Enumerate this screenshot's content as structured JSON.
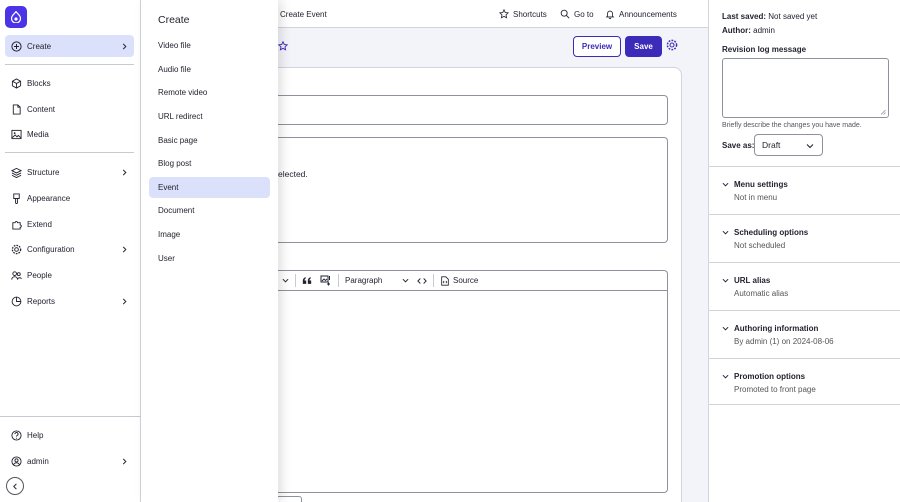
{
  "colors": {
    "accent": "#3c2bb9",
    "active_bg": "#dbe1fb",
    "logo_bg": "#4b33e6"
  },
  "sidebar": {
    "items": [
      {
        "label": "Create",
        "icon": "plus-circle-icon",
        "has_children": true,
        "active": true
      },
      {
        "label": "Blocks",
        "icon": "blocks-icon",
        "has_children": false
      },
      {
        "label": "Content",
        "icon": "file-icon",
        "has_children": false
      },
      {
        "label": "Media",
        "icon": "image-icon",
        "has_children": false
      },
      {
        "label": "Structure",
        "icon": "layers-icon",
        "has_children": true
      },
      {
        "label": "Appearance",
        "icon": "brush-icon",
        "has_children": false
      },
      {
        "label": "Extend",
        "icon": "puzzle-icon",
        "has_children": false
      },
      {
        "label": "Configuration",
        "icon": "gear-icon",
        "has_children": true
      },
      {
        "label": "People",
        "icon": "people-icon",
        "has_children": false
      },
      {
        "label": "Reports",
        "icon": "chart-icon",
        "has_children": true
      }
    ],
    "help": "Help",
    "user": "admin"
  },
  "flyout": {
    "title": "Create",
    "items": [
      "Video file",
      "Audio file",
      "Remote video",
      "URL redirect",
      "Basic page",
      "Blog post",
      "Event",
      "Document",
      "Image",
      "User"
    ],
    "active": "Event"
  },
  "topbar": {
    "breadcrumb": "Create Event",
    "shortcuts": "Shortcuts",
    "goto": "Go to",
    "announcements": "Announcements"
  },
  "main": {
    "preview": "Preview",
    "save": "Save",
    "field_text": "elected.",
    "toolbar": {
      "paragraph": "Paragraph",
      "source": "Source"
    }
  },
  "meta": {
    "last_saved_label": "Last saved:",
    "last_saved_value": "Not saved yet",
    "author_label": "Author:",
    "author_value": "admin",
    "revision_label": "Revision log message",
    "revision_help": "Briefly describe the changes you have made.",
    "save_as_label": "Save as:",
    "save_as_value": "Draft",
    "sections": [
      {
        "title": "Menu settings",
        "summary": "Not in menu"
      },
      {
        "title": "Scheduling options",
        "summary": "Not scheduled"
      },
      {
        "title": "URL alias",
        "summary": "Automatic alias"
      },
      {
        "title": "Authoring information",
        "summary": "By admin (1) on 2024-08-06"
      },
      {
        "title": "Promotion options",
        "summary": "Promoted to front page"
      }
    ]
  }
}
